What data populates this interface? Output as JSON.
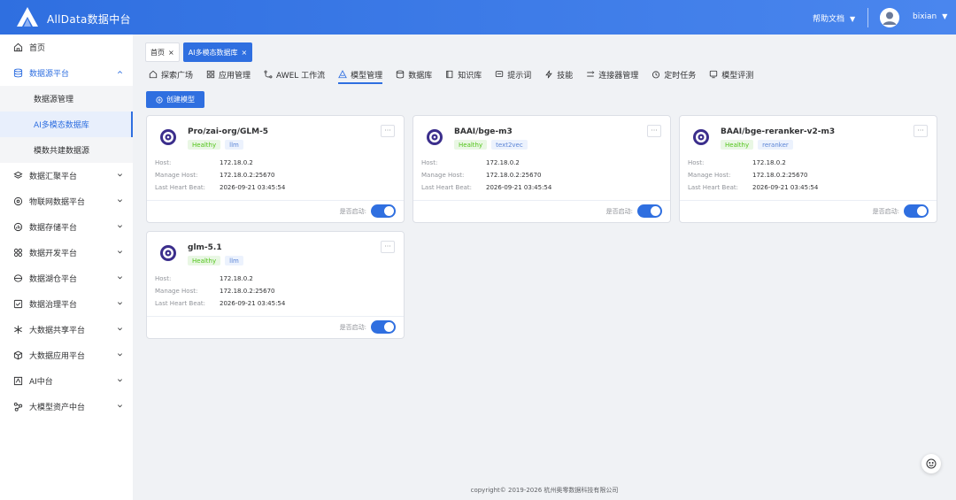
{
  "header": {
    "app_title": "AllData数据中台",
    "help_label": "帮助文档",
    "help_caret": "▼",
    "user_name": "bixian",
    "user_caret": "▼"
  },
  "sidebar": {
    "items": [
      {
        "label": "首页",
        "icon": "home-icon"
      },
      {
        "label": "数据源平台",
        "icon": "database-icon"
      },
      {
        "label": "数据汇聚平台",
        "icon": "layers-icon"
      },
      {
        "label": "物联网数据平台",
        "icon": "iot-icon"
      },
      {
        "label": "数据存储平台",
        "icon": "chart-icon"
      },
      {
        "label": "数据开发平台",
        "icon": "grid-icon"
      },
      {
        "label": "数据湖仓平台",
        "icon": "lake-icon"
      },
      {
        "label": "数据治理平台",
        "icon": "governance-icon"
      },
      {
        "label": "大数据共享平台",
        "icon": "share-icon"
      },
      {
        "label": "大数据应用平台",
        "icon": "cube-icon"
      },
      {
        "label": "AI中台",
        "icon": "ai-icon"
      },
      {
        "label": "大模型资产中台",
        "icon": "asset-icon"
      }
    ],
    "sub_items": [
      {
        "label": "数据源管理"
      },
      {
        "label": "AI多模态数据库"
      },
      {
        "label": "模数共建数据源"
      }
    ]
  },
  "tabs": {
    "home": "首页",
    "active": "AI多模态数据库",
    "close": "×"
  },
  "subnav": {
    "items": [
      {
        "label": "探索广场",
        "icon": "home-icon"
      },
      {
        "label": "应用管理",
        "icon": "apps-icon"
      },
      {
        "label": "AWEL 工作流",
        "icon": "workflow-icon"
      },
      {
        "label": "模型管理",
        "icon": "model-icon"
      },
      {
        "label": "数据库",
        "icon": "database-icon"
      },
      {
        "label": "知识库",
        "icon": "book-icon"
      },
      {
        "label": "提示词",
        "icon": "prompt-icon"
      },
      {
        "label": "技能",
        "icon": "bolt-icon"
      },
      {
        "label": "连接器管理",
        "icon": "connector-icon"
      },
      {
        "label": "定时任务",
        "icon": "clock-icon"
      },
      {
        "label": "模型评测",
        "icon": "eval-icon"
      }
    ]
  },
  "toolbar": {
    "create_label": "创建模型"
  },
  "labels": {
    "host": "Host:",
    "manage_host": "Manage Host:",
    "last_heart_beat": "Last Heart Beat:",
    "enabled": "是否启动:",
    "more": "···"
  },
  "models": [
    {
      "name": "Pro/zai-org/GLM-5",
      "health": "Healthy",
      "kind": "llm",
      "host": "172.18.0.2",
      "manage_host": "172.18.0.2:25670",
      "heartbeat": "2026-09-21 03:45:54",
      "enabled": true
    },
    {
      "name": "BAAI/bge-m3",
      "health": "Healthy",
      "kind": "text2vec",
      "host": "172.18.0.2",
      "manage_host": "172.18.0.2:25670",
      "heartbeat": "2026-09-21 03:45:54",
      "enabled": true
    },
    {
      "name": "BAAI/bge-reranker-v2-m3",
      "health": "Healthy",
      "kind": "reranker",
      "host": "172.18.0.2",
      "manage_host": "172.18.0.2:25670",
      "heartbeat": "2026-09-21 03:45:54",
      "enabled": true
    },
    {
      "name": "glm-5.1",
      "health": "Healthy",
      "kind": "llm",
      "host": "172.18.0.2",
      "manage_host": "172.18.0.2:25670",
      "heartbeat": "2026-09-21 03:45:54",
      "enabled": true
    }
  ],
  "footer": {
    "copyright": "copyright© 2019-2026 杭州奥零数据科技有限公司"
  },
  "colors": {
    "primary": "#2f6fe0",
    "healthy_bg": "#e9f7e4",
    "healthy_text": "#52c41a",
    "kind_bg": "#ecf2fd",
    "kind_text": "#5b84d6"
  }
}
